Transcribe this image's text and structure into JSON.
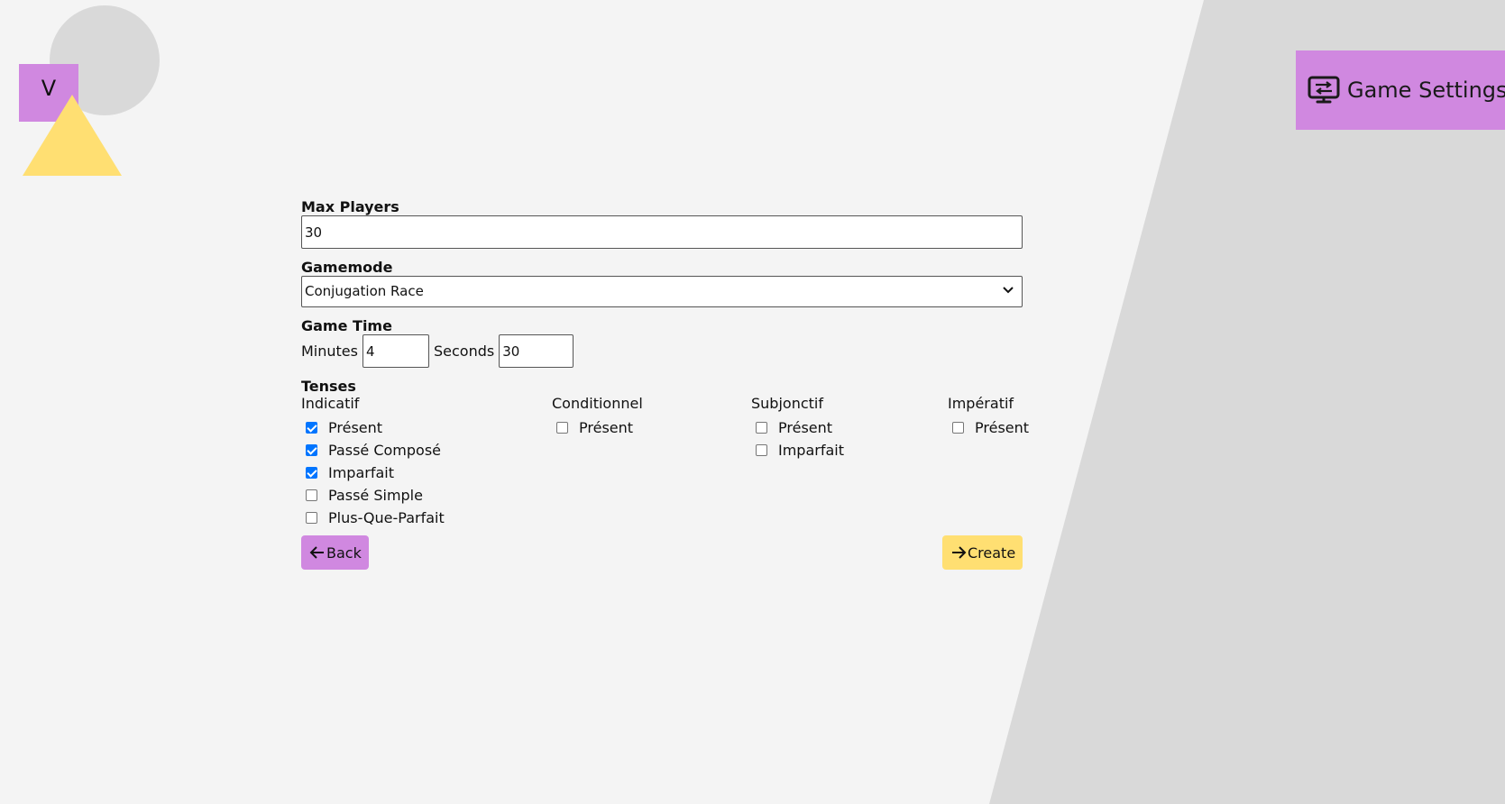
{
  "logo": {
    "letter": "V"
  },
  "header": {
    "title": "Game Settings",
    "icon": "settings-monitor-icon"
  },
  "form": {
    "max_players": {
      "label": "Max Players",
      "value": "30"
    },
    "gamemode": {
      "label": "Gamemode",
      "selected": "Conjugation Race"
    },
    "game_time": {
      "label": "Game Time",
      "minutes_label": "Minutes",
      "minutes_value": "4",
      "seconds_label": "Seconds",
      "seconds_value": "30"
    },
    "tenses": {
      "label": "Tenses",
      "groups": [
        {
          "name": "Indicatif",
          "options": [
            {
              "label": "Présent",
              "checked": true
            },
            {
              "label": "Passé Composé",
              "checked": true
            },
            {
              "label": "Imparfait",
              "checked": true
            },
            {
              "label": "Passé Simple",
              "checked": false
            },
            {
              "label": "Plus-Que-Parfait",
              "checked": false
            }
          ]
        },
        {
          "name": "Conditionnel",
          "options": [
            {
              "label": "Présent",
              "checked": false
            }
          ]
        },
        {
          "name": "Subjonctif",
          "options": [
            {
              "label": "Présent",
              "checked": false
            },
            {
              "label": "Imparfait",
              "checked": false
            }
          ]
        },
        {
          "name": "Impératif",
          "options": [
            {
              "label": "Présent",
              "checked": false
            }
          ]
        }
      ]
    }
  },
  "buttons": {
    "back_label": "Back",
    "create_label": "Create"
  },
  "colors": {
    "background": "#f4f4f4",
    "slant_panel": "#d9d9d9",
    "accent_purple": "#d088e0",
    "accent_yellow": "#ffdf72",
    "logo_circle": "#d9d9d9",
    "checkbox_checked": "#0075ff"
  }
}
